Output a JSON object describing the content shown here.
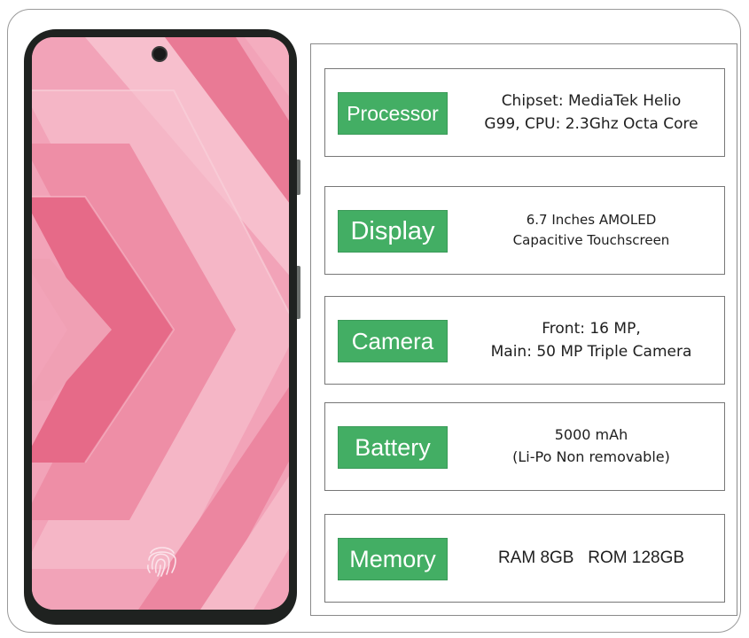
{
  "colors": {
    "tag_green": "#43ae64",
    "screen_pink": "#f2a4ba",
    "phone_frame": "#1f2220"
  },
  "phone": {
    "fingerprint_icon": "fingerprint-icon",
    "camera_icon": "front-camera-icon"
  },
  "specs": [
    {
      "label": "Processor",
      "value": "Chipset: MediaTek Helio\nG99, CPU: 2.3Ghz Octa Core"
    },
    {
      "label": "Display",
      "value": "6.7 Inches AMOLED\nCapacitive Touchscreen"
    },
    {
      "label": "Camera",
      "value": "Front: 16 MP,\nMain: 50 MP Triple Camera"
    },
    {
      "label": "Battery",
      "value": "5000 mAh\n(Li-Po Non removable)"
    },
    {
      "label": "Memory",
      "value": "RAM 8GB   ROM 128GB"
    }
  ]
}
